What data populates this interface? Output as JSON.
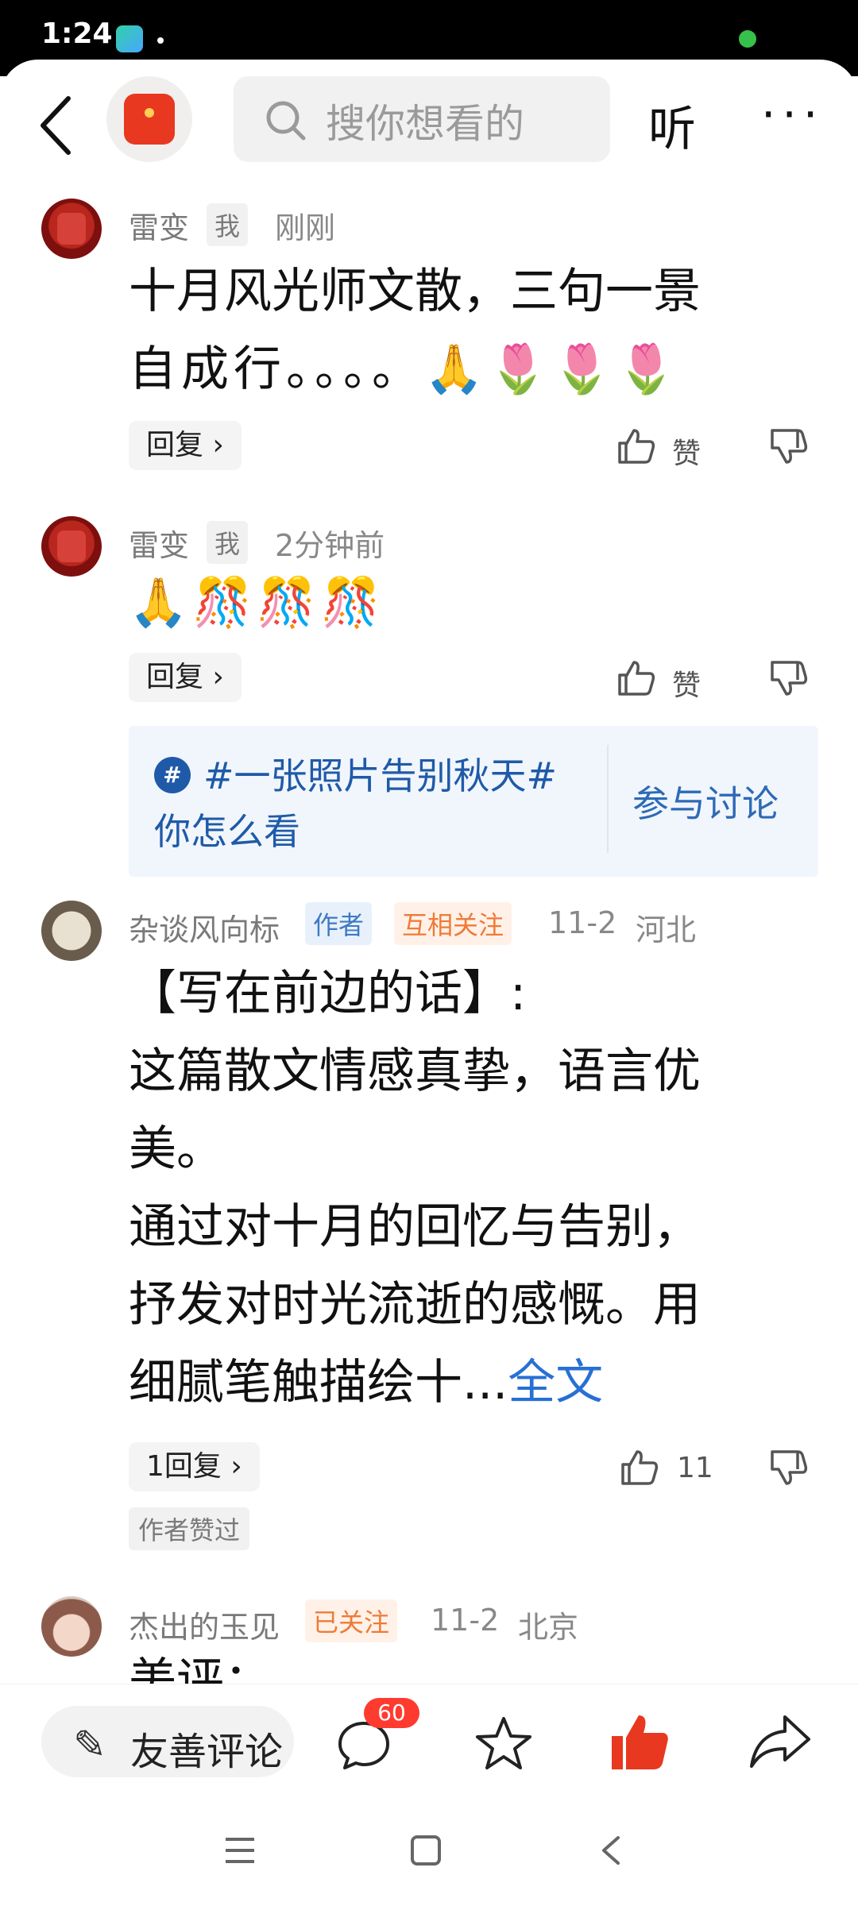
{
  "status_bar": {
    "time": "1:24"
  },
  "header": {
    "search_placeholder": "搜你想看的",
    "listen_label": "听",
    "more_label": "···"
  },
  "comments": [
    {
      "username": "雷变",
      "tag": "我",
      "time": "刚刚",
      "body_lines": [
        "十月风光师文散，三句一景",
        "自成行。。。。🙏🌷🌷🌷"
      ],
      "reply_label": "回复 ›",
      "like_label": "赞"
    },
    {
      "username": "雷变",
      "tag": "我",
      "time": "2分钟前",
      "body_lines": [
        "🙏🎊🎊🎊"
      ],
      "reply_label": "回复 ›",
      "like_label": "赞"
    },
    {
      "username": "杂谈风向标",
      "tag_author": "作者",
      "tag_follow": "互相关注",
      "time": "11-2",
      "location": "河北",
      "body_lines": [
        "【写在前边的话】:",
        "这篇散文情感真挚，语言优",
        "美。",
        "通过对十月的回忆与告别，",
        "抒发对时光流逝的感慨。用",
        "细腻笔触描绘十..."
      ],
      "full_text_link": "全文",
      "reply_label": "1回复 ›",
      "like_count": "11",
      "author_liked": "作者赞过"
    },
    {
      "username": "杰出的玉见",
      "tag_follow": "已关注",
      "time": "11-2",
      "location": "北京",
      "body_partial": "美评："
    }
  ],
  "topic": {
    "hash_symbol": "#",
    "title": "#一张照片告别秋天#",
    "subtitle": "你怎么看",
    "join_label": "参与讨论"
  },
  "bottom_bar": {
    "comment_placeholder": "友善评论",
    "comment_count": "60"
  },
  "colors": {
    "accent_blue": "#2770d4",
    "like_red": "#e8381f",
    "badge_red": "#ff3b30"
  }
}
